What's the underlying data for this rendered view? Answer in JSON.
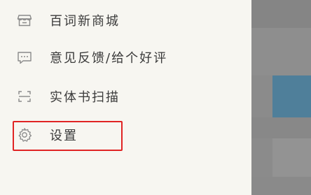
{
  "menu": {
    "items": [
      {
        "label": "百词新商城",
        "icon": "store-icon"
      },
      {
        "label": "意见反馈/给个好评",
        "icon": "chat-bubble-icon"
      },
      {
        "label": "实体书扫描",
        "icon": "scan-frame-icon"
      },
      {
        "label": "设置",
        "icon": "gear-icon"
      }
    ]
  },
  "colors": {
    "drawer_background": "#f7f6f1",
    "text": "#3b3b3b",
    "icon": "#8a8a8a",
    "highlight_border": "#e02424",
    "overlay": "#8b8b8b",
    "overlay_accent": "#4f7f9a"
  }
}
